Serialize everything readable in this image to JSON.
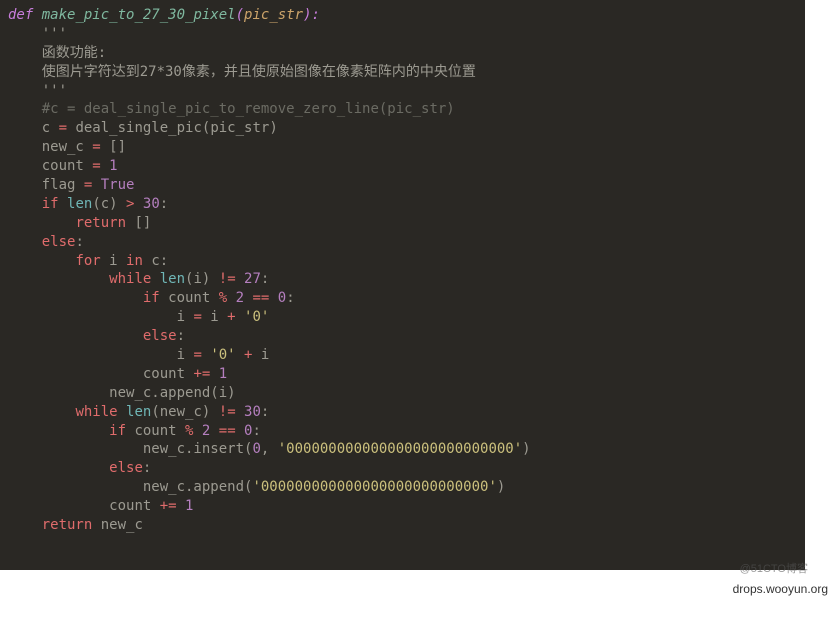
{
  "code": {
    "def_kw": "def",
    "func_name": "make_pic_to_27_30_pixel",
    "param": "pic_str",
    "triple1": "'''",
    "doc_line1": "函数功能:",
    "doc_line2": "使图片字符达到27*30像素，并且使原始图像在像素矩阵内的中央位置",
    "triple2": "'''",
    "comment1": "#c = deal_single_pic_to_remove_zero_line(pic_str)",
    "assign_c": "c ",
    "eq": "=",
    "sp": " ",
    "deal_call": "deal_single_pic(pic_str)",
    "new_c_lhs": "new_c ",
    "new_c_rhs": " []",
    "count_lhs": "count ",
    "one": " 1",
    "flag_lhs": "flag ",
    "true_v": " True",
    "if_kw": "if",
    "len_kw": "len",
    "c_var": "(c) ",
    "gt": ">",
    "thirty": " 30",
    "colon": ":",
    "return_kw": "return",
    "empty_list": " []",
    "else_kw": "else",
    "for_kw": "for",
    "i_var": " i ",
    "in_kw": "in",
    "c_colon": " c",
    "while_kw": "while",
    "len_i": "(i) ",
    "neq": "!=",
    "twentyseven": " 27",
    "count_mod": " count ",
    "pct": "%",
    "two": " 2 ",
    "eqeq": "==",
    "zero": " 0",
    "i_eq": "i ",
    "plus": "+",
    "zstr": " '0'",
    "zstr2": "'0' ",
    "i_only": " i",
    "count_var": "count ",
    "pluseq": "+=",
    "append1": "new_c.append(i)",
    "len_newc": "(new_c) ",
    "thirty2": " 30",
    "insert_call": "new_c.insert(",
    "zero_arg": "0",
    "comma": ", ",
    "longzstr": "'000000000000000000000000000'",
    "close_paren": ")",
    "append2": "new_c.append(",
    "ret_newc": " new_c"
  },
  "watermark": "@51CTO博客",
  "source": "drops.wooyun.org"
}
